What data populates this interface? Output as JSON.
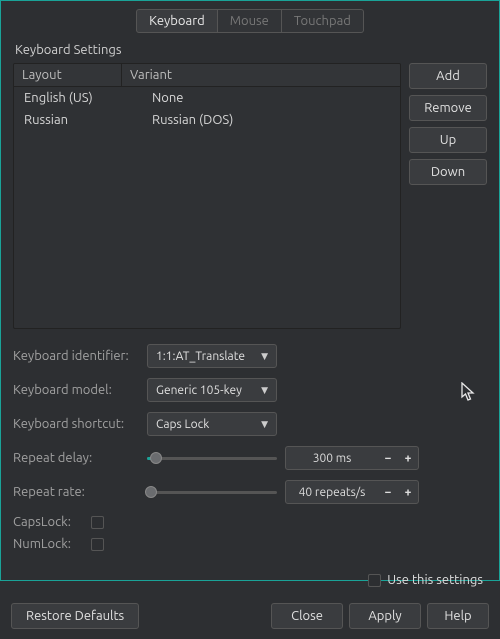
{
  "tabs": {
    "keyboard": "Keyboard",
    "mouse": "Mouse",
    "touchpad": "Touchpad",
    "active": 0
  },
  "section_title": "Keyboard Settings",
  "table": {
    "headers": {
      "layout": "Layout",
      "variant": "Variant"
    },
    "rows": [
      {
        "layout": "English (US)",
        "variant": "None"
      },
      {
        "layout": "Russian",
        "variant": "Russian (DOS)"
      }
    ]
  },
  "side_buttons": {
    "add": "Add",
    "remove": "Remove",
    "up": "Up",
    "down": "Down"
  },
  "form": {
    "identifier_label": "Keyboard identifier:",
    "identifier_value": "1:1:AT_Translate",
    "model_label": "Keyboard model:",
    "model_value": "Generic 105-key",
    "shortcut_label": "Keyboard shortcut:",
    "shortcut_value": "Caps Lock",
    "repeat_delay_label": "Repeat delay:",
    "repeat_delay_value": "300 ms",
    "repeat_delay_pct": 7,
    "repeat_rate_label": "Repeat rate:",
    "repeat_rate_value": "40 repeats/s",
    "repeat_rate_pct": 3,
    "capslock_label": "CapsLock:",
    "numlock_label": "NumLock:",
    "use_settings_label": "Use this settings"
  },
  "footer": {
    "restore": "Restore Defaults",
    "close": "Close",
    "apply": "Apply",
    "help": "Help"
  },
  "colors": {
    "accent": "#1aa398"
  }
}
